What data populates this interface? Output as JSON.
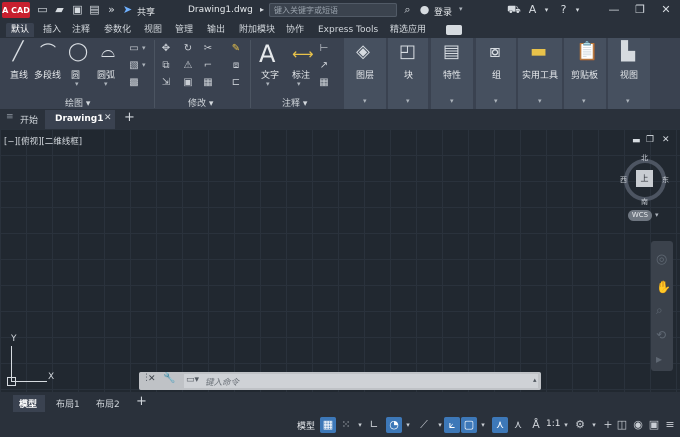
{
  "app": {
    "logo_text": "A CAD"
  },
  "titlebar": {
    "share_label": "共享",
    "document_title": "Drawing1.dwg",
    "search_placeholder": "键入关键字或短语",
    "login_label": "登录",
    "minimize": "—",
    "restore": "❐",
    "close": "✕"
  },
  "menu_tabs": [
    "默认",
    "插入",
    "注释",
    "参数化",
    "视图",
    "管理",
    "输出",
    "附加模块",
    "协作",
    "Express Tools",
    "精选应用"
  ],
  "ribbon": {
    "draw": {
      "title": "绘图 ▾",
      "line": "直线",
      "polyline": "多段线",
      "circle": "圆",
      "arc": "圆弧"
    },
    "modify": {
      "title": "修改 ▾"
    },
    "annotation": {
      "title": "注释 ▾",
      "text": "文字",
      "dimension": "标注"
    },
    "layers": "图层",
    "block": "块",
    "properties": "特性",
    "groups": "组",
    "utilities": "实用工具",
    "clipboard": "剪贴板",
    "view": "视图"
  },
  "doc_tabs": {
    "start": "开始",
    "drawing": "Drawing1",
    "close_glyph": "✕",
    "add_glyph": "+"
  },
  "viewport": {
    "label": "[−][俯视][二维线框]",
    "viewcube": {
      "north": "北",
      "south": "南",
      "east": "东",
      "west": "西",
      "face": "上"
    },
    "wcs": "WCS",
    "ucs_x": "X",
    "ucs_y": "Y"
  },
  "command_line": {
    "placeholder": "键入命令"
  },
  "layout_tabs": [
    "模型",
    "布局1",
    "布局2"
  ],
  "status": {
    "model_label": "模型",
    "scale": "1:1"
  },
  "colors": {
    "accent": "#3d78b8",
    "logo_red": "#c8202f",
    "canvas": "#212830"
  }
}
